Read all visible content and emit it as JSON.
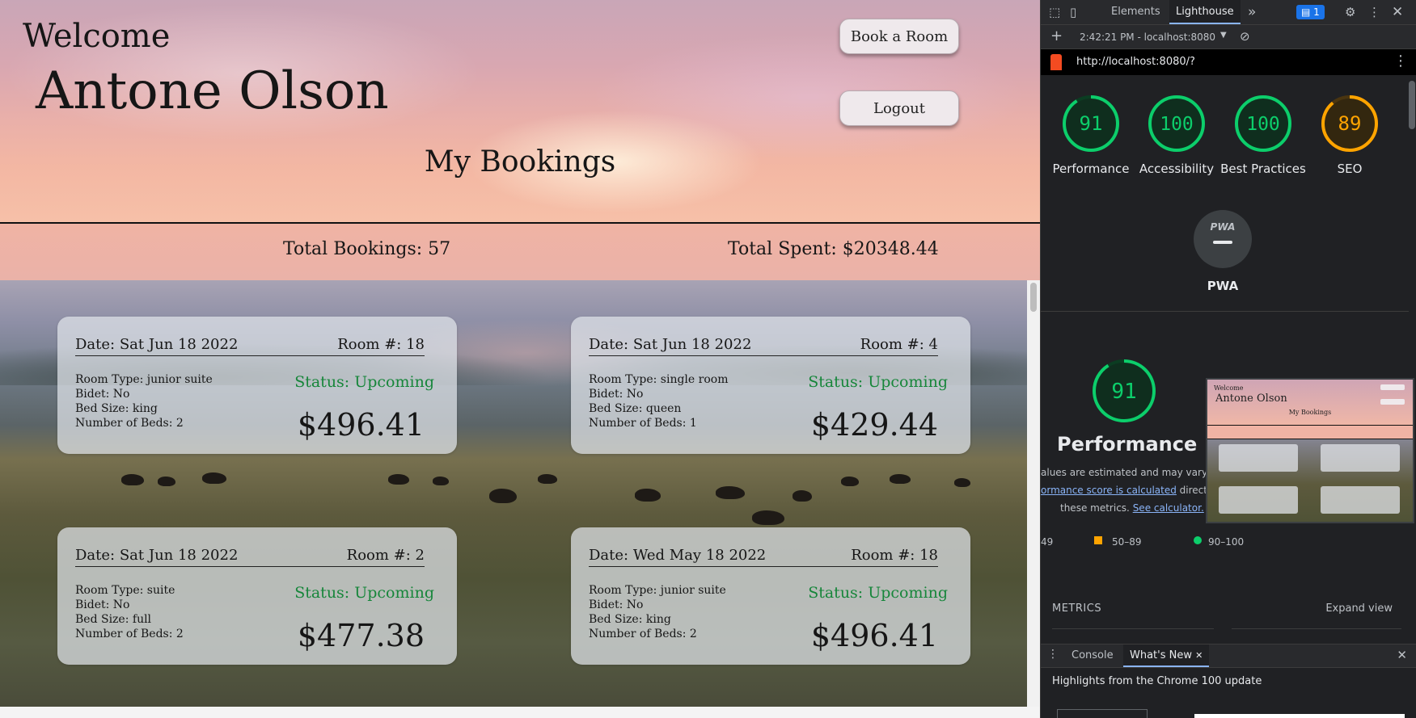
{
  "app": {
    "welcome": "Welcome",
    "user_name": "Antone Olson",
    "book_button": "Book a Room",
    "logout_button": "Logout",
    "section_title": "My Bookings",
    "total_bookings": "Total Bookings: 57",
    "total_spent": "Total Spent: $20348.44",
    "status_color": "#16863a",
    "bookings": [
      {
        "date": "Date: Sat Jun 18 2022",
        "room": "Room #: 18",
        "room_type": "Room Type: junior suite",
        "bidet": "Bidet: No",
        "bed_size": "Bed Size: king",
        "beds": "Number of Beds: 2",
        "status": "Status: Upcoming",
        "price": "$496.41"
      },
      {
        "date": "Date: Sat Jun 18 2022",
        "room": "Room #: 4",
        "room_type": "Room Type: single room",
        "bidet": "Bidet: No",
        "bed_size": "Bed Size: queen",
        "beds": "Number of Beds: 1",
        "status": "Status: Upcoming",
        "price": "$429.44"
      },
      {
        "date": "Date: Sat Jun 18 2022",
        "room": "Room #: 2",
        "room_type": "Room Type: suite",
        "bidet": "Bidet: No",
        "bed_size": "Bed Size: full",
        "beds": "Number of Beds: 2",
        "status": "Status: Upcoming",
        "price": "$477.38"
      },
      {
        "date": "Date: Wed May 18 2022",
        "room": "Room #: 18",
        "room_type": "Room Type: junior suite",
        "bidet": "Bidet: No",
        "bed_size": "Bed Size: king",
        "beds": "Number of Beds: 2",
        "status": "Status: Upcoming",
        "price": "$496.41"
      }
    ]
  },
  "devtools": {
    "tabs": [
      "Elements",
      "Lighthouse"
    ],
    "active_tab": "Lighthouse",
    "more_tabs": "»",
    "issues_count": "1",
    "report_time": "2:42:21 PM - localhost:8080",
    "url": "http://localhost:8080/?",
    "scores": [
      {
        "label": "Performance",
        "value": "91",
        "color": "#0cce6b",
        "fraction": 0.91
      },
      {
        "label": "Accessibility",
        "value": "100",
        "color": "#0cce6b",
        "fraction": 1.0
      },
      {
        "label": "Best Practices",
        "value": "100",
        "color": "#0cce6b",
        "fraction": 1.0
      },
      {
        "label": "SEO",
        "value": "89",
        "color": "#ffa400",
        "fraction": 0.89
      }
    ],
    "pwa_label": "PWA",
    "pwa_badge": "PWA",
    "perf_score": "91",
    "perf_title": "Performance",
    "perf_note_1": "alues are estimated and may vary. T",
    "perf_link": "ormance score is calculated",
    "perf_note_2": " directly",
    "perf_note_3": "these metrics.",
    "perf_calc_link": "See calculator.",
    "legend_fail": "49",
    "legend_average": "50–89",
    "legend_pass": "90–100",
    "metrics_title": "METRICS",
    "expand_view": "Expand view",
    "drawer_tabs": [
      "Console",
      "What's New"
    ],
    "drawer_active": "What's New",
    "drawer_text": "Highlights from the Chrome 100 update"
  }
}
